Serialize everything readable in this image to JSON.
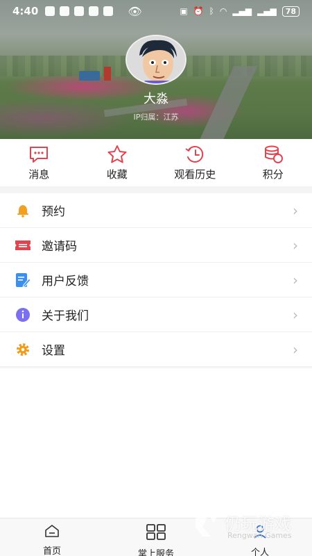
{
  "status_bar": {
    "time": "4:40",
    "battery": "78"
  },
  "profile": {
    "name": "大淼",
    "ip_label": "IP归属：",
    "ip_location": "江苏"
  },
  "quick_actions": [
    {
      "label": "消息",
      "icon": "message-icon"
    },
    {
      "label": "收藏",
      "icon": "star-icon"
    },
    {
      "label": "观看历史",
      "icon": "history-icon"
    },
    {
      "label": "积分",
      "icon": "points-icon"
    }
  ],
  "menu": [
    {
      "label": "预约",
      "icon": "bell-icon"
    },
    {
      "label": "邀请码",
      "icon": "ticket-icon"
    },
    {
      "label": "用户反馈",
      "icon": "feedback-icon"
    },
    {
      "label": "关于我们",
      "icon": "info-icon"
    },
    {
      "label": "设置",
      "icon": "gear-icon"
    }
  ],
  "bottom_nav": [
    {
      "label": "首页",
      "icon": "home-icon"
    },
    {
      "label": "掌上服务",
      "icon": "grid-icon"
    },
    {
      "label": "个人",
      "icon": "user-icon"
    }
  ],
  "watermark": {
    "title": "仍玩游戏",
    "subtitle": "Rengwan Games"
  },
  "colors": {
    "accent_red": "#e0454f",
    "bell": "#f2a020",
    "feedback": "#3b8ff0",
    "info": "#7c6ff0",
    "gear": "#f29a1a"
  }
}
